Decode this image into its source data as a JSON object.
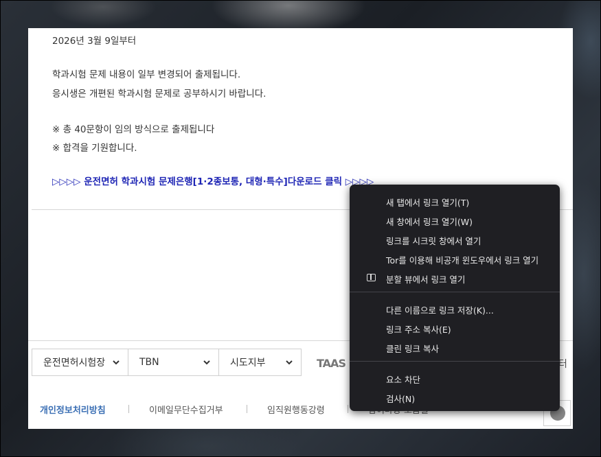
{
  "notice": {
    "date_line": "2026년 3월 9일부터",
    "para1_line1": "학과시험 문제 내용이 일부 변경되어 출제됩니다.",
    "para1_line2": "응시생은 개편된 학과시험 문제로 공부하시기 바랍니다.",
    "para2_line1": "※ 총 40문항이 임의 방식으로 출제됩니다",
    "para2_line2": "※ 합격을 기원합니다.",
    "download_link": "▷▷▷▷ 운전면허 학과시험 문제은행[1·2종보통, 대형·특수]다운로드 클릭 ▷▷▷▷"
  },
  "selects": [
    {
      "value": "운전면허시험장"
    },
    {
      "value": "TBN"
    },
    {
      "value": "시도지부"
    }
  ],
  "taas_label": "TAAS",
  "partial_right_text": "터",
  "footer": {
    "links": [
      "개인정보처리방침",
      "이메일무단수집거부",
      "임직원행동강령",
      "참여마당 모음길"
    ]
  },
  "context_menu": {
    "items": [
      {
        "label": "새 탭에서 링크 열기(T)",
        "icon": ""
      },
      {
        "label": "새 창에서 링크 열기(W)",
        "icon": ""
      },
      {
        "label": "링크를 시크릿 창에서 열기",
        "icon": ""
      },
      {
        "label": "Tor를 이용해 비공개 윈도우에서 링크 열기",
        "icon": ""
      },
      {
        "label": "분할 뷰에서 링크 열기",
        "icon": "split-view-icon"
      },
      {
        "label": "다른 이름으로 링크 저장(K)...",
        "icon": ""
      },
      {
        "label": "링크 주소 복사(E)",
        "icon": ""
      },
      {
        "label": "클린 링크 복사",
        "icon": ""
      },
      {
        "label": "요소 차단",
        "icon": ""
      },
      {
        "label": "검사(N)",
        "icon": ""
      }
    ]
  },
  "colors": {
    "link_blue": "#1f26b5",
    "footer_primary": "#3b6fb4",
    "menu_bg": "#1f1f23"
  }
}
